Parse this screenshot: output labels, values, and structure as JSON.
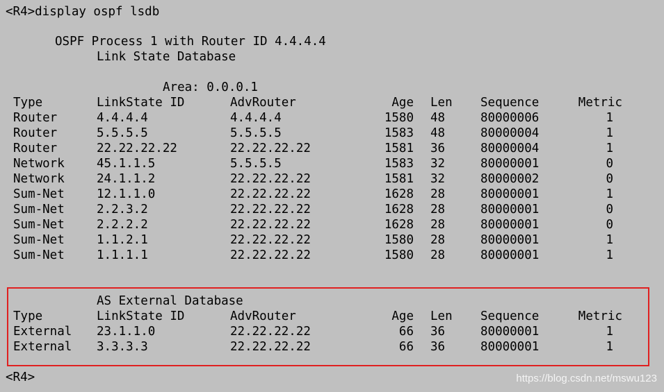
{
  "terminal": {
    "command_line": "<R4>display ospf lsdb",
    "process_line": "OSPF Process 1 with Router ID 4.4.4.4",
    "lsdb_title": "Link State Database",
    "area_line": "Area: 0.0.0.1",
    "headers": [
      "Type",
      "LinkState ID",
      "AdvRouter",
      "Age",
      "Len",
      "Sequence",
      "Metric"
    ],
    "rows": [
      [
        "Router",
        "4.4.4.4",
        "4.4.4.4",
        "1580",
        "48",
        "80000006",
        "1"
      ],
      [
        "Router",
        "5.5.5.5",
        "5.5.5.5",
        "1583",
        "48",
        "80000004",
        "1"
      ],
      [
        "Router",
        "22.22.22.22",
        "22.22.22.22",
        "1581",
        "36",
        "80000004",
        "1"
      ],
      [
        "Network",
        "45.1.1.5",
        "5.5.5.5",
        "1583",
        "32",
        "80000001",
        "0"
      ],
      [
        "Network",
        "24.1.1.2",
        "22.22.22.22",
        "1581",
        "32",
        "80000002",
        "0"
      ],
      [
        "Sum-Net",
        "12.1.1.0",
        "22.22.22.22",
        "1628",
        "28",
        "80000001",
        "1"
      ],
      [
        "Sum-Net",
        "2.2.3.2",
        "22.22.22.22",
        "1628",
        "28",
        "80000001",
        "0"
      ],
      [
        "Sum-Net",
        "2.2.2.2",
        "22.22.22.22",
        "1628",
        "28",
        "80000001",
        "0"
      ],
      [
        "Sum-Net",
        "1.1.2.1",
        "22.22.22.22",
        "1580",
        "28",
        "80000001",
        "1"
      ],
      [
        "Sum-Net",
        "1.1.1.1",
        "22.22.22.22",
        "1580",
        "28",
        "80000001",
        "1"
      ]
    ],
    "external_title": "AS External Database",
    "external_headers": [
      "Type",
      "LinkState ID",
      "AdvRouter",
      "Age",
      "Len",
      "Sequence",
      "Metric"
    ],
    "external_rows": [
      [
        "External",
        "23.1.1.0",
        "22.22.22.22",
        "66",
        "36",
        "80000001",
        "1"
      ],
      [
        "External",
        "3.3.3.3",
        "22.22.22.22",
        "66",
        "36",
        "80000001",
        "1"
      ]
    ],
    "prompt_line": "<R4>",
    "highlight_color": "#e02020",
    "watermark": "https://blog.csdn.net/mswu123"
  }
}
